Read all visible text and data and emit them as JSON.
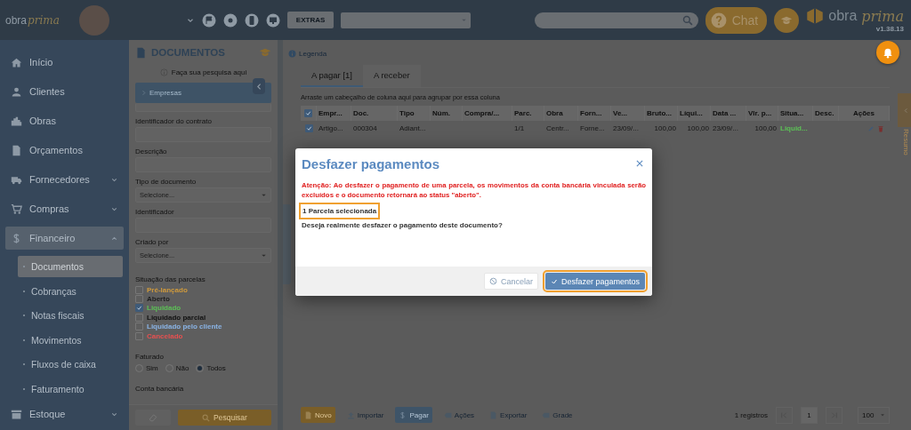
{
  "topbar": {
    "logo": {
      "word": "obra",
      "script": "prima"
    },
    "extras_button": "EXTRAS",
    "chat_button": "Chat",
    "brand": {
      "word": "obra",
      "script": "prima"
    },
    "version": "v1.38.13"
  },
  "sidebar": {
    "items": [
      {
        "label": "Início",
        "kind": "link",
        "selected": false
      },
      {
        "label": "Clientes",
        "kind": "link",
        "selected": false
      },
      {
        "label": "Obras",
        "kind": "link",
        "selected": false
      },
      {
        "label": "Orçamentos",
        "kind": "link",
        "selected": false
      },
      {
        "label": "Fornecedores",
        "kind": "group",
        "expanded": false,
        "selected": false
      },
      {
        "label": "Compras",
        "kind": "group",
        "expanded": false,
        "selected": false
      },
      {
        "label": "Financeiro",
        "kind": "group",
        "expanded": true,
        "selected": true,
        "children": [
          {
            "label": "Documentos",
            "selected": true
          },
          {
            "label": "Cobranças",
            "selected": false
          },
          {
            "label": "Notas fiscais",
            "selected": false
          },
          {
            "label": "Movimentos",
            "selected": false
          },
          {
            "label": "Fluxos de caixa",
            "selected": false
          },
          {
            "label": "Faturamento",
            "selected": false
          }
        ]
      },
      {
        "label": "Estoque",
        "kind": "group",
        "expanded": false,
        "selected": false
      }
    ]
  },
  "documents_panel": {
    "title": "DOCUMENTOS",
    "hint": "Faça sua pesquisa aqui",
    "accordion": {
      "label": "Empresas",
      "expanded": false
    },
    "fields": [
      {
        "kind": "text"
      },
      {
        "label": "Identificador do contrato",
        "kind": "text"
      },
      {
        "label": "Descrição",
        "kind": "text"
      },
      {
        "label": "Tipo de documento",
        "kind": "select",
        "placeholder": "Selecione..."
      },
      {
        "label": "Identificador",
        "kind": "text"
      },
      {
        "label": "Criado por",
        "kind": "select",
        "placeholder": "Selecione..."
      }
    ],
    "status_filter": {
      "label": "Situação das parcelas",
      "options": [
        {
          "label": "Pré-lançado",
          "checked": false,
          "color": "#d09a3c"
        },
        {
          "label": "Aberto",
          "checked": false,
          "color": "#1e1e1e"
        },
        {
          "label": "Liquidado",
          "checked": true,
          "color": "#5cc056"
        },
        {
          "label": "Liquidado parcial",
          "checked": false,
          "color": "#111111"
        },
        {
          "label": "Liquidado pelo cliente",
          "checked": false,
          "color": "#8ab4e6"
        },
        {
          "label": "Cancelado",
          "checked": false,
          "color": "#e85050"
        }
      ]
    },
    "billed_filter": {
      "label": "Faturado",
      "options": [
        {
          "label": "Sim",
          "selected": false
        },
        {
          "label": "Não",
          "selected": false
        },
        {
          "label": "Todos",
          "selected": true
        }
      ]
    },
    "bank_account": {
      "label": "Conta bancária"
    },
    "search_button": "Pesquisar"
  },
  "main": {
    "legend": "Legenda",
    "tabs": [
      {
        "label": "A pagar [1]",
        "selected": true
      },
      {
        "label": "A receber",
        "selected": false
      }
    ],
    "group_hint": "Arraste um cabeçalho de coluna aqui para agrupar por essa coluna",
    "table": {
      "all_checked": true,
      "columns": [
        "Empr...",
        "Doc.",
        "Tipo",
        "Núm.",
        "Compra/...",
        "Parc.",
        "Obra",
        "Forn...",
        "Ve...",
        "Bruto...",
        "Líqui...",
        "Data ...",
        "Vlr. p...",
        "Situa...",
        "Desc.",
        "Ações"
      ],
      "rows": [
        {
          "checked": true,
          "cells": [
            {
              "text": "Artigo..."
            },
            {
              "text": "000304"
            },
            {
              "text": "Adiant..."
            },
            {
              "text": ""
            },
            {
              "text": ""
            },
            {
              "text": "1/1"
            },
            {
              "text": "Centr..."
            },
            {
              "text": "Forne..."
            },
            {
              "text": "23/09/..."
            },
            {
              "text": "100,00",
              "kind": "number"
            },
            {
              "text": "100,00",
              "kind": "number"
            },
            {
              "text": "23/09/..."
            },
            {
              "text": "100,00",
              "kind": "number"
            },
            {
              "text": "Liquid...",
              "color": "#5cc056"
            },
            {
              "text": ""
            }
          ]
        }
      ]
    },
    "toolbar": [
      {
        "label": "Novo",
        "kind": "primary"
      },
      {
        "label": "Importar",
        "kind": "link"
      },
      {
        "label": "Pagar",
        "kind": "action"
      },
      {
        "label": "Ações",
        "kind": "link"
      },
      {
        "label": "Exportar",
        "kind": "link"
      },
      {
        "label": "Grade",
        "kind": "link"
      }
    ],
    "pager": {
      "count": "1 registros",
      "page": "1",
      "page_size": "100"
    },
    "side_panel": {
      "label": "Resumo"
    }
  },
  "modal": {
    "title": "Desfazer pagamentos",
    "warning": "Atenção: Ao desfazer o pagamento de uma parcela, os movimentos da conta bancária vinculada serão excluídos e o documento retornará ao status \"aberto\".",
    "selection": {
      "text": "1 Parcela selecionada",
      "highlighted": true
    },
    "question": "Deseja realmente desfazer o pagamento deste documento?",
    "cancel_button": "Cancelar",
    "confirm_button": {
      "label": "Desfazer pagamentos",
      "highlighted": true
    }
  }
}
